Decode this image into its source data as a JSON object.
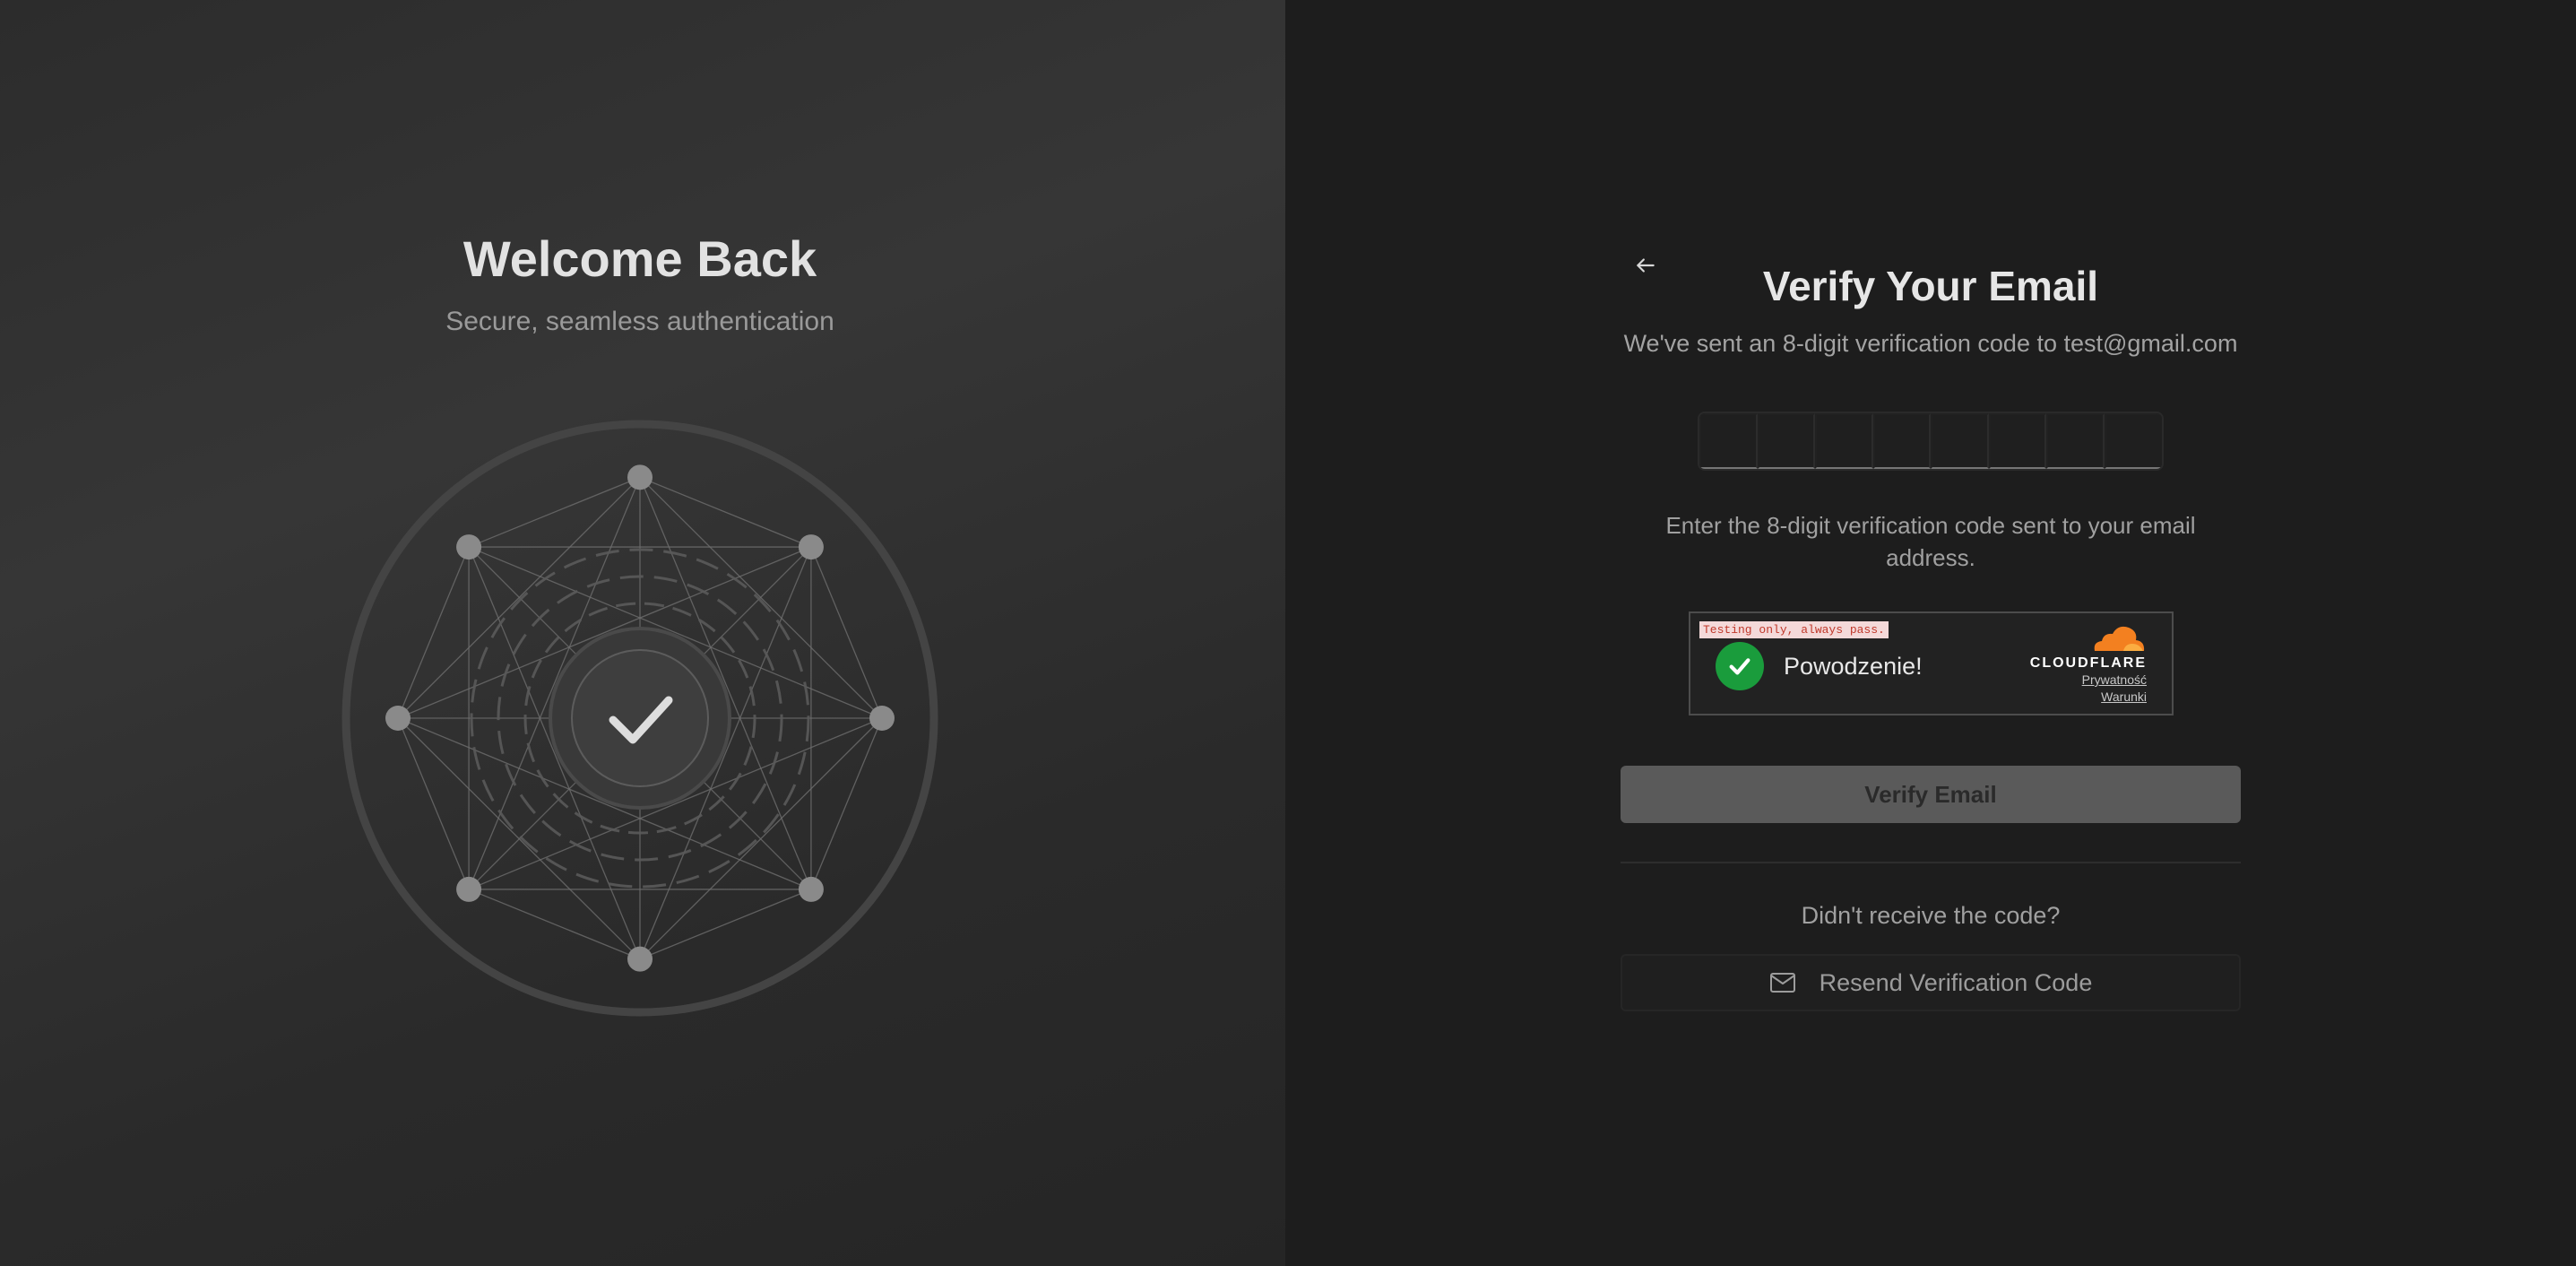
{
  "left": {
    "title": "Welcome Back",
    "subtitle": "Secure, seamless authentication"
  },
  "verify": {
    "back_icon": "arrow-left-icon",
    "title": "Verify Your Email",
    "subtitle": "We've sent an 8-digit verification code to test@gmail.com",
    "code_length": 8,
    "code_values": [
      "",
      "",
      "",
      "",
      "",
      "",
      "",
      ""
    ],
    "hint": "Enter the 8-digit verification code sent to your email address.",
    "captcha": {
      "testing_badge": "Testing only, always pass.",
      "status": "Powodzenie!",
      "brand": "CLOUDFLARE",
      "privacy_link": "Prywatność",
      "terms_link": "Warunki"
    },
    "submit_label": "Verify Email",
    "resend_prompt": "Didn't receive the code?",
    "resend_label": "Resend Verification Code",
    "resend_icon": "mail-icon"
  },
  "colors": {
    "left_bg": "#333333",
    "right_bg": "#1d1d1d",
    "success": "#1a9c3c",
    "cloudflare_orange": "#f38020"
  }
}
